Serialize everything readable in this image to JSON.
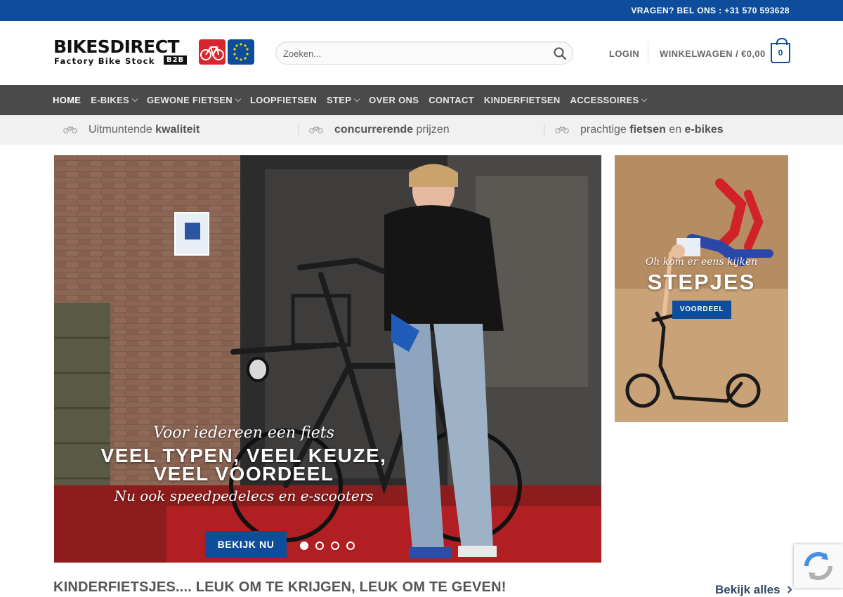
{
  "topbar": {
    "phone_text": "VRAGEN? BEL ONS : +31 570 593628"
  },
  "header": {
    "logo": {
      "brand": "BIKESDIRECT",
      "tagline": "Factory Bike Stock",
      "badge": "B2B"
    },
    "search": {
      "placeholder": "Zoeken..."
    },
    "login_label": "LOGIN",
    "cart_label": "WINKELWAGEN / €0,00",
    "cart_count": "0"
  },
  "nav": {
    "items": [
      {
        "label": "HOME",
        "active": true,
        "has_dropdown": false
      },
      {
        "label": "E-BIKES",
        "active": false,
        "has_dropdown": true
      },
      {
        "label": "GEWONE FIETSEN",
        "active": false,
        "has_dropdown": true
      },
      {
        "label": "LOOPFIETSEN",
        "active": false,
        "has_dropdown": false
      },
      {
        "label": "STEP",
        "active": false,
        "has_dropdown": true
      },
      {
        "label": "OVER ONS",
        "active": false,
        "has_dropdown": false
      },
      {
        "label": "CONTACT",
        "active": false,
        "has_dropdown": false
      },
      {
        "label": "KINDERFIETSEN",
        "active": false,
        "has_dropdown": false
      },
      {
        "label": "ACCESSOIRES",
        "active": false,
        "has_dropdown": true
      }
    ]
  },
  "usp": [
    {
      "pre": "Uitmuntende ",
      "bold1": "kwaliteit",
      "mid": "",
      "bold2": ""
    },
    {
      "pre": "",
      "bold1": "concurrerende",
      "mid": " prijzen",
      "bold2": ""
    },
    {
      "pre": "prachtige ",
      "bold1": "fietsen",
      "mid": " en ",
      "bold2": "e-bikes"
    }
  ],
  "hero": {
    "script_top": "Voor iedereen een fiets",
    "headline_line1": "VEEL TYPEN, VEEL KEUZE,",
    "headline_line2": "VEEL VOORDEEL",
    "script_bottom": "Nu ook speedpedelecs en e-scooters",
    "button_label": "BEKIJK NU",
    "slide_count": 4,
    "active_slide": 1
  },
  "promo": {
    "script": "Oh kom er eens kijken",
    "title": "STEPJES",
    "button_label": "VOORDEEL"
  },
  "section": {
    "title": "KINDERFIETSJES.... LEUK OM TE KRIJGEN, LEUK OM TE GEVEN!",
    "view_all_label": "Bekijk alles"
  },
  "colors": {
    "primary": "#0d4d9c",
    "nav_bg": "#4a4a4a",
    "usp_bg": "#f1f1f1",
    "logo_red": "#d7262e"
  },
  "icons": {
    "search": "search-icon",
    "cart": "cart-icon",
    "usp": "bicycle-icon",
    "dropdown": "chevron-down-icon",
    "view_all": "chevron-right-icon",
    "recaptcha": "recaptcha-icon"
  }
}
